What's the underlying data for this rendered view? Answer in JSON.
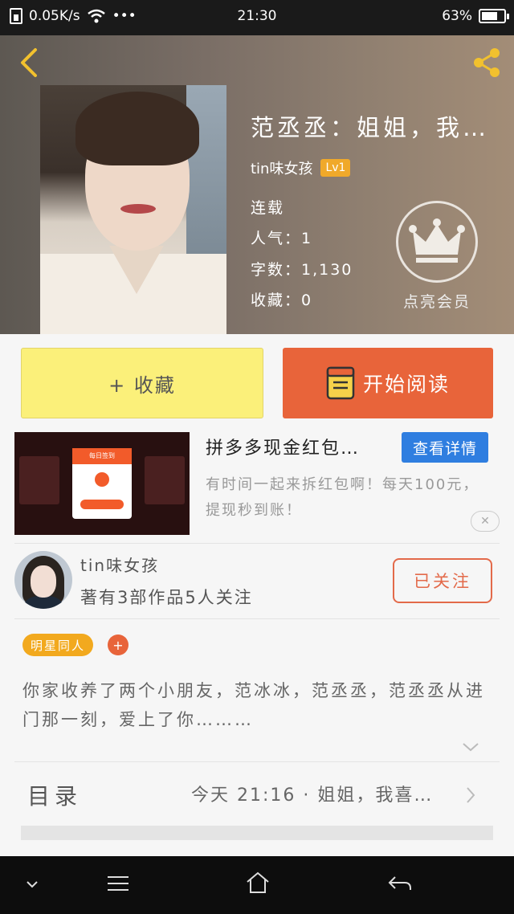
{
  "status_bar": {
    "speed": "0.05K/s",
    "more": "•••",
    "time": "21:30",
    "battery": "63%"
  },
  "book": {
    "title": "范丞丞：姐姐，我…",
    "author": "tin味女孩",
    "level": "Lv1",
    "status": "连载",
    "popularity": "人气：1",
    "word_count": "字数：1,130",
    "favorites": "收藏：0",
    "vip_label": "点亮会员"
  },
  "actions": {
    "favorite": "+ 收藏",
    "start_reading": "开始阅读"
  },
  "ad": {
    "title": "拼多多现金红包…",
    "detail_button": "查看详情",
    "description": "有时间一起来拆红包啊！每天100元，提现秒到账！",
    "image_card_title": "每日签到"
  },
  "author_card": {
    "name": "tin味女孩",
    "stats": "著有3部作品5人关注",
    "follow_state": "已关注"
  },
  "tags": [
    "明星同人"
  ],
  "tag_add": "+",
  "summary": "你家收养了两个小朋友，范冰冰，范丞丞，范丞丞从进门那一刻，爱上了你………",
  "toc": {
    "label": "目录",
    "latest": "今天 21:16 · 姐姐，我喜…"
  },
  "colors": {
    "accent_orange": "#e8643a",
    "favorite_yellow": "#fbf07a",
    "badge_yellow": "#f0a92a",
    "link_blue": "#2f7ee0"
  }
}
